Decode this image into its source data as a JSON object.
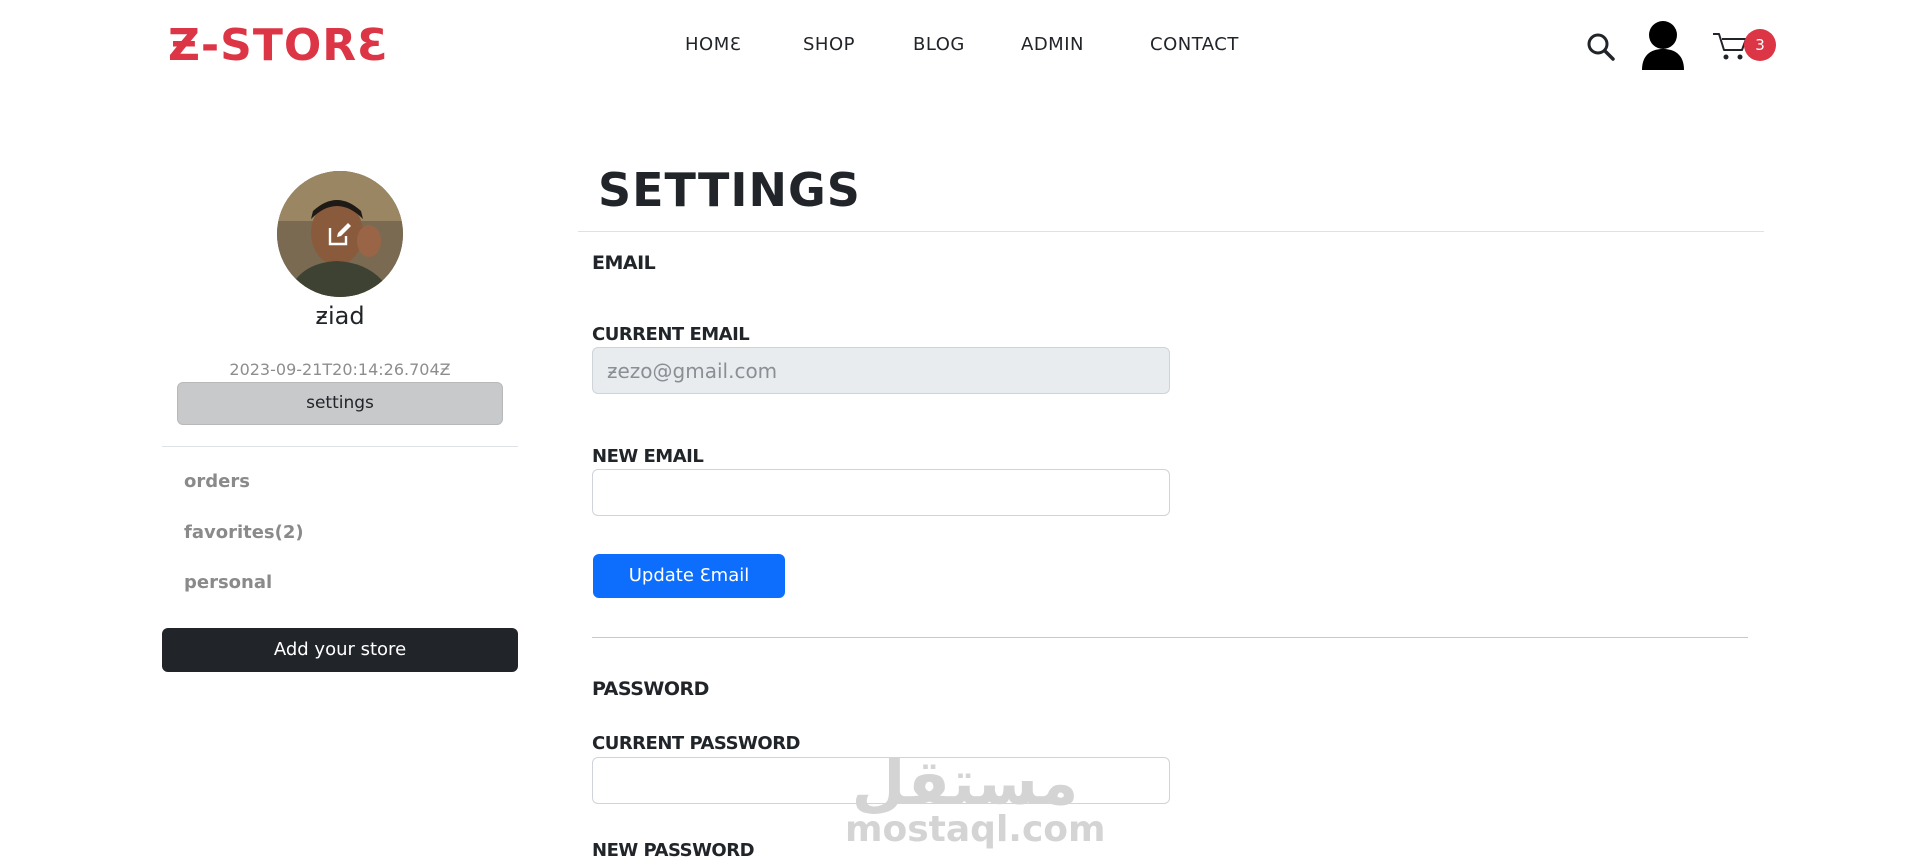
{
  "brand": {
    "logo": "Ƶ-STORƐ",
    "accent": "#dc3545"
  },
  "nav": {
    "items": [
      "HOMƐ",
      "SHOP",
      "BLOG",
      "ADMIN",
      "CONTACT"
    ]
  },
  "header": {
    "cart_count": "3",
    "icons": [
      "search-icon",
      "user-icon",
      "cart-icon"
    ]
  },
  "profile": {
    "name": "ƶiad",
    "created": "2023-09-21T20:14:26.704Ƶ",
    "settings_label": "settings",
    "links": [
      "orders",
      "favorites(2)",
      "personal"
    ],
    "add_store_label": "Add your store"
  },
  "settings": {
    "title": "SETTINGS",
    "email_section": "EMAIL",
    "current_email_label": "CURRENT EMAIL",
    "current_email_placeholder": "ƶezo@gmail.com",
    "new_email_label": "NEW EMAIL",
    "new_email_value": "",
    "update_email_label": "Update Ɛmail",
    "password_section": "PASSWORD",
    "current_password_label": "CURRENT PASSWORD",
    "new_password_label": "NEW PASSWORD"
  },
  "watermark": {
    "arabic": "مستقل",
    "latin": "mostaql.com"
  },
  "colors": {
    "primary": "#0d6efd",
    "dark": "#212529",
    "badge": "#dc3545"
  }
}
